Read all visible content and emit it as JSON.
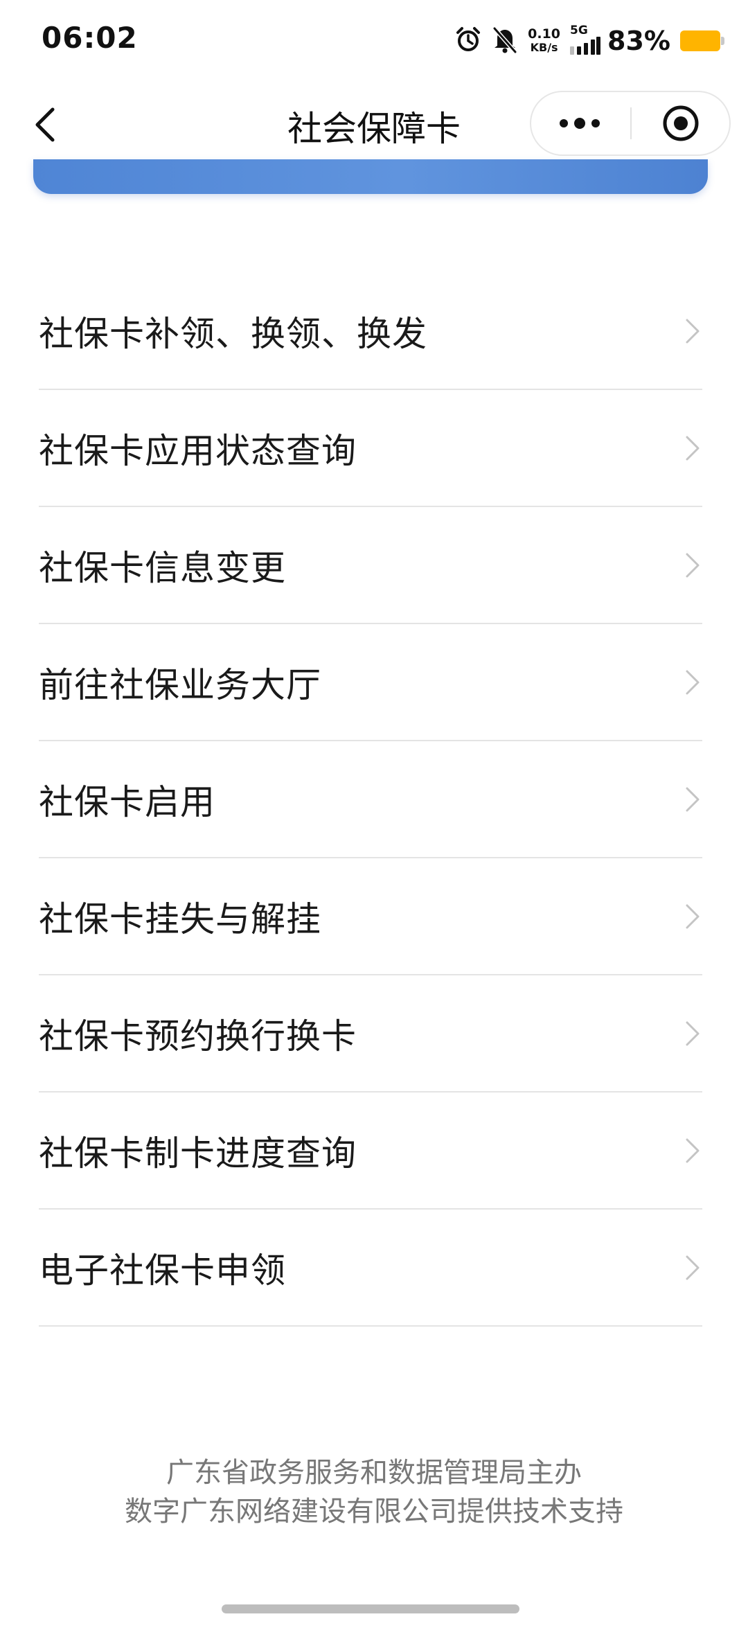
{
  "status_bar": {
    "time": "06:02",
    "net_speed_value": "0.10",
    "net_speed_unit": "KB/s",
    "network_type": "5G",
    "battery_percent": "83%",
    "battery_level": 0.83,
    "battery_color": "#ffb400",
    "icons": [
      "alarm-icon",
      "mute-bell-icon",
      "signal-icon",
      "battery-icon"
    ]
  },
  "header": {
    "title": "社会保障卡",
    "back_icon": "chevron-left-icon",
    "more_icon": "more-dots-icon",
    "close_icon": "target-close-icon"
  },
  "banner": {
    "color": "#5a8fdb"
  },
  "menu": {
    "items": [
      {
        "label": "社保卡补领、换领、换发"
      },
      {
        "label": "社保卡应用状态查询"
      },
      {
        "label": "社保卡信息变更"
      },
      {
        "label": "前往社保业务大厅"
      },
      {
        "label": "社保卡启用"
      },
      {
        "label": "社保卡挂失与解挂"
      },
      {
        "label": "社保卡预约换行换卡"
      },
      {
        "label": "社保卡制卡进度查询"
      },
      {
        "label": "电子社保卡申领"
      }
    ]
  },
  "footer": {
    "line1": "广东省政务服务和数据管理局主办",
    "line2": "数字广东网络建设有限公司提供技术支持"
  }
}
